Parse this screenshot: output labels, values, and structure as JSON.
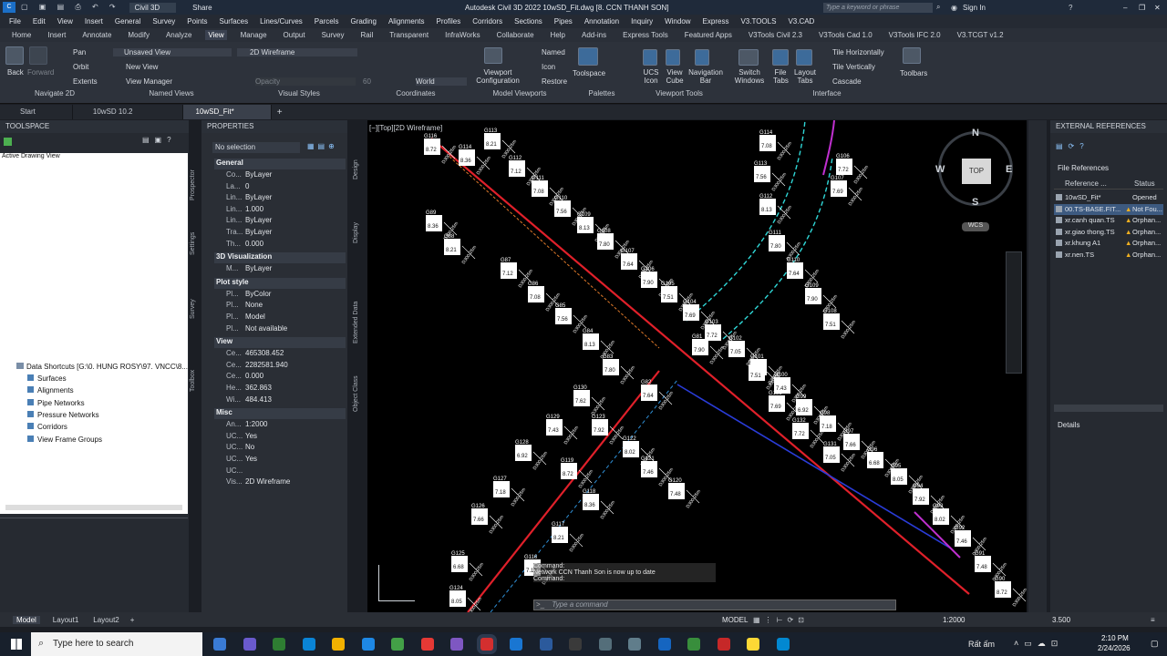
{
  "title": {
    "app_name": "Civil 3D",
    "window_title": "Autodesk Civil 3D 2022   10wSD_Fit.dwg [8. CCN THANH SON]",
    "share": "Share",
    "search_placeholder": "Type a keyword or phrase",
    "sign_in": "Sign In"
  },
  "menu": [
    "File",
    "Edit",
    "View",
    "Insert",
    "General",
    "Survey",
    "Points",
    "Surfaces",
    "Lines/Curves",
    "Parcels",
    "Grading",
    "Alignments",
    "Profiles",
    "Corridors",
    "Sections",
    "Pipes",
    "Annotation",
    "Inquiry",
    "Window",
    "Express",
    "V3.TOOLS",
    "V3.CAD"
  ],
  "ribbon_tabs": [
    "Home",
    "Insert",
    "Annotate",
    "Modify",
    "Analyze",
    "View",
    "Manage",
    "Output",
    "Survey",
    "Rail",
    "Transparent",
    "InfraWorks",
    "Collaborate",
    "Help",
    "Add-ins",
    "Express Tools",
    "Featured Apps",
    "V3Tools Civil 2.3",
    "V3Tools Cad 1.0",
    "V3Tools IFC 2.0",
    "V3.TCGT v1.2"
  ],
  "active_ribbon_tab": "View",
  "ribbon": {
    "back": "Back",
    "forward": "Forward",
    "pan": "Pan",
    "orbit": "Orbit",
    "extents": "Extents",
    "unsaved_view": "Unsaved View",
    "new_view": "New View",
    "view_manager": "View Manager",
    "visual_style": "2D Wireframe",
    "opacity": "Opacity",
    "opacity_value": "60",
    "world": "World",
    "named": "Named",
    "icon": "Icon",
    "restore": "Restore",
    "viewport_config": "Viewport Configuration",
    "toolspace": "Toolspace",
    "ucs_icon": "UCS Icon",
    "view_cube": "View Cube",
    "nav_bar": "Navigation Bar",
    "switch_windows": "Switch Windows",
    "file_tabs": "File Tabs",
    "layout_tabs": "Layout Tabs",
    "tile_h": "Tile Horizontally",
    "tile_v": "Tile Vertically",
    "cascade": "Cascade",
    "toolbars": "Toolbars",
    "groups": {
      "navigate": "Navigate 2D",
      "named_views": "Named Views",
      "visual_styles": "Visual Styles",
      "coordinates": "Coordinates",
      "model_viewports": "Model Viewports",
      "palettes": "Palettes",
      "viewport_tools": "Viewport Tools",
      "interface": "Interface"
    }
  },
  "doc_tabs": [
    "Start",
    "10wSD 10.2",
    "10wSD_Fit*"
  ],
  "toolspace": {
    "title": "TOOLSPACE",
    "dropdown": "Active Drawing View",
    "shortcuts_root": "Data Shortcuts [G:\\0. HUNG ROSY\\97. VNCC\\8...",
    "items": [
      "Surfaces",
      "Alignments",
      "Pipe Networks",
      "Pressure Networks",
      "Corridors",
      "View Frame Groups"
    ],
    "side_tabs": [
      "Prospector",
      "Settings",
      "Survey",
      "Toolbox"
    ]
  },
  "properties": {
    "title": "PROPERTIES",
    "selection": "No selection",
    "side_tabs": [
      "Design",
      "Display",
      "Extended Data",
      "Object Class"
    ],
    "general": "General",
    "general_rows": [
      {
        "k": "Co...",
        "v": "ByLayer"
      },
      {
        "k": "La...",
        "v": "0"
      },
      {
        "k": "Lin...",
        "v": "ByLayer"
      },
      {
        "k": "Lin...",
        "v": "1.000"
      },
      {
        "k": "Lin...",
        "v": "ByLayer"
      },
      {
        "k": "Tra...",
        "v": "ByLayer"
      },
      {
        "k": "Th...",
        "v": "0.000"
      }
    ],
    "viz3d": "3D Visualization",
    "viz_rows": [
      {
        "k": "M...",
        "v": "ByLayer"
      }
    ],
    "plot": "Plot style",
    "plot_rows": [
      {
        "k": "Pl...",
        "v": "ByColor"
      },
      {
        "k": "Pl...",
        "v": "None"
      },
      {
        "k": "Pl...",
        "v": "Model"
      },
      {
        "k": "Pl...",
        "v": "Not available"
      }
    ],
    "view": "View",
    "view_rows": [
      {
        "k": "Ce...",
        "v": "465308.452"
      },
      {
        "k": "Ce...",
        "v": "2282581.940"
      },
      {
        "k": "Ce...",
        "v": "0.000"
      },
      {
        "k": "He...",
        "v": "362.863"
      },
      {
        "k": "Wi...",
        "v": "484.413"
      }
    ],
    "misc": "Misc",
    "misc_rows": [
      {
        "k": "An...",
        "v": "1:2000"
      },
      {
        "k": "UC...",
        "v": "Yes"
      },
      {
        "k": "UC...",
        "v": "No"
      },
      {
        "k": "UC...",
        "v": "Yes"
      },
      {
        "k": "UC...",
        "v": ""
      },
      {
        "k": "Vis...",
        "v": "2D Wireframe"
      }
    ]
  },
  "canvas": {
    "viewport_label": "[−][Top][2D Wireframe]",
    "compass": {
      "n": "N",
      "s": "S",
      "e": "E",
      "w": "W",
      "top": "TOP",
      "wcs": "WCS"
    },
    "command_lines": [
      "Command:",
      "Network CCN Thanh Son is now up to date",
      "Command:"
    ],
    "command_placeholder": "Type a command",
    "labels": [
      "G116",
      "G114",
      "G113",
      "G112",
      "G111",
      "G110",
      "G109",
      "G108",
      "G107",
      "G106",
      "G105",
      "G104",
      "G103",
      "G102",
      "G101",
      "G100",
      "G99",
      "G98",
      "G97",
      "G96",
      "G95",
      "G94",
      "G93",
      "G92",
      "G91",
      "G90",
      "G89",
      "G88",
      "G87",
      "G86",
      "G85",
      "G84",
      "G83",
      "G82",
      "G81",
      "G134",
      "G133",
      "G132",
      "G131",
      "G130",
      "G129",
      "G128",
      "G127",
      "G126",
      "G125",
      "G124",
      "G123",
      "G122",
      "G121",
      "G120",
      "G119",
      "G118",
      "G117"
    ],
    "elevations": [
      "8.72",
      "8.36",
      "8.21",
      "7.12",
      "7.08",
      "7.56",
      "8.13",
      "7.80",
      "7.64",
      "7.90",
      "7.51",
      "7.69",
      "7.72",
      "7.05",
      "7.62",
      "7.43",
      "6.92",
      "7.18",
      "7.66",
      "6.68",
      "8.05",
      "7.92",
      "8.02",
      "7.46",
      "7.48"
    ]
  },
  "xref": {
    "title": "EXTERNAL REFERENCES",
    "section": "File References",
    "col_ref": "Reference ...",
    "col_status": "Status",
    "rows": [
      {
        "name": "10wSD_Fit*",
        "status": "Opened"
      },
      {
        "name": "00.TS-BASE.FIT...",
        "status": "Not Fou..."
      },
      {
        "name": "xr.canh quan.TS",
        "status": "Orphan..."
      },
      {
        "name": "xr.giao thong.TS",
        "status": "Orphan..."
      },
      {
        "name": "xr.khung A1",
        "status": "Orphan..."
      },
      {
        "name": "xr.nen.TS",
        "status": "Orphan..."
      }
    ],
    "details": "Details"
  },
  "status": {
    "tabs": [
      "Model",
      "Layout1",
      "Layout2"
    ],
    "model": "MODEL",
    "scale": "1:2000",
    "value": "3.500"
  },
  "taskbar": {
    "search_placeholder": "Type here to search",
    "weather": "Rất ấm",
    "time": "2:10 PM",
    "date": "2/24/2026"
  },
  "colors": {
    "red_pipe": "#e0202a",
    "cyan": "#2fd6d6",
    "magenta": "#c030d0",
    "blue": "#2a3cd8",
    "accent": "#0a84d6"
  }
}
